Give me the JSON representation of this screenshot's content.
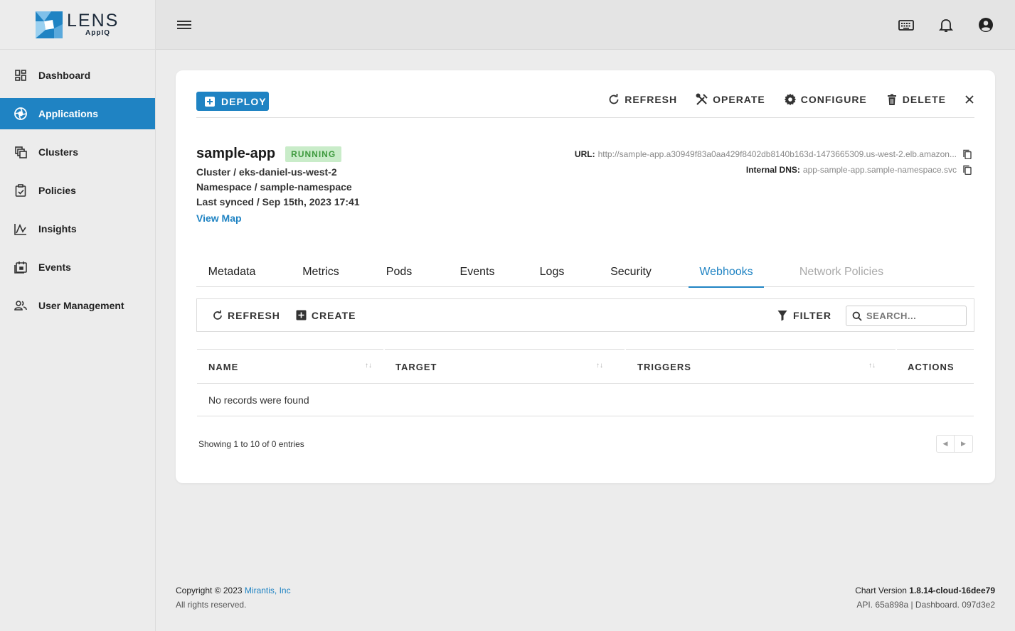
{
  "brand": {
    "name": "LENS",
    "sub": "AppIQ"
  },
  "sidebar": {
    "items": [
      {
        "label": "Dashboard",
        "icon": "dashboard-icon"
      },
      {
        "label": "Applications",
        "icon": "applications-icon",
        "active": true
      },
      {
        "label": "Clusters",
        "icon": "clusters-icon"
      },
      {
        "label": "Policies",
        "icon": "policies-icon"
      },
      {
        "label": "Insights",
        "icon": "insights-icon"
      },
      {
        "label": "Events",
        "icon": "events-icon"
      },
      {
        "label": "User Management",
        "icon": "users-icon"
      }
    ]
  },
  "toolbar": {
    "deploy_label": "DEPLOY",
    "refresh_label": "REFRESH",
    "operate_label": "OPERATE",
    "configure_label": "CONFIGURE",
    "delete_label": "DELETE"
  },
  "app": {
    "name": "sample-app",
    "status": "RUNNING",
    "cluster": "Cluster / eks-daniel-us-west-2",
    "namespace": "Namespace / sample-namespace",
    "last_synced": "Last synced / Sep 15th, 2023 17:41",
    "view_map": "View Map",
    "url_label": "URL:",
    "url_value": "http://sample-app.a30949f83a0aa429f8402db8140b163d-1473665309.us-west-2.elb.amazon...",
    "dns_label": "Internal DNS:",
    "dns_value": "app-sample-app.sample-namespace.svc"
  },
  "tabs": [
    "Metadata",
    "Metrics",
    "Pods",
    "Events",
    "Logs",
    "Security",
    "Webhooks",
    "Network Policies"
  ],
  "active_tab": "Webhooks",
  "table": {
    "refresh_label": "REFRESH",
    "create_label": "CREATE",
    "filter_label": "FILTER",
    "search_placeholder": "SEARCH...",
    "columns": [
      "NAME",
      "TARGET",
      "TRIGGERS",
      "ACTIONS"
    ],
    "empty_text": "No records were found",
    "entries_text": "Showing 1 to 10 of 0 entries"
  },
  "footer": {
    "copyright": "Copyright © 2023 ",
    "company": "Mirantis, Inc",
    "rights": "All rights reserved.",
    "chart_label": "Chart Version ",
    "chart_version": "1.8.14-cloud-16dee79",
    "build": "API. 65a898a | Dashboard. 097d3e2"
  },
  "colors": {
    "accent": "#1f83c3",
    "running_bg": "#c9ecc9",
    "running_fg": "#3e9a3e"
  }
}
